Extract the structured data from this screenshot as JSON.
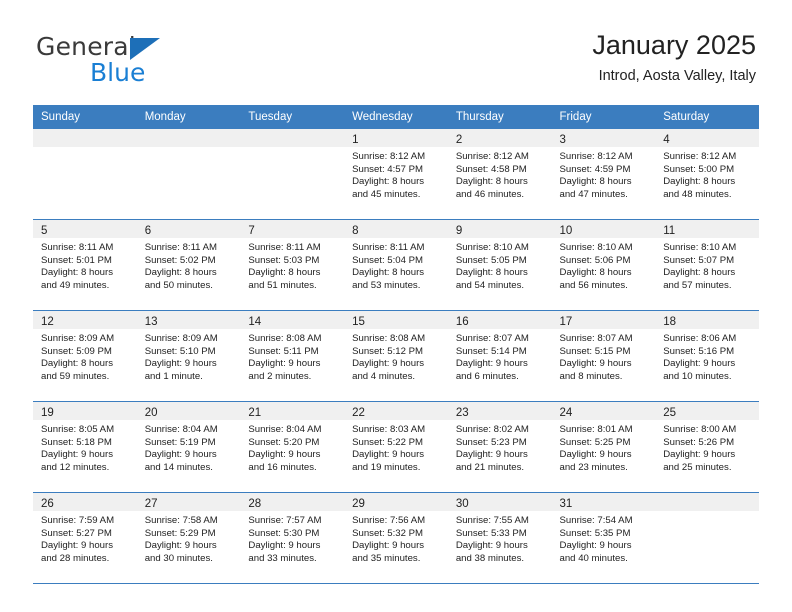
{
  "brand": {
    "name_part1": "General",
    "name_part2": "Blue",
    "accent_color": "#1a7fd4",
    "triangle_color": "#1d6fb8"
  },
  "header": {
    "title": "January 2025",
    "subtitle": "Introd, Aosta Valley, Italy"
  },
  "theme": {
    "header_row_color": "#3b7dbf",
    "day_band_color": "#f0f0f0",
    "row_divider_color": "#3b7dbf"
  },
  "weekday_headers": [
    "Sunday",
    "Monday",
    "Tuesday",
    "Wednesday",
    "Thursday",
    "Friday",
    "Saturday"
  ],
  "weeks": [
    [
      {
        "day": "",
        "sunrise": "",
        "sunset": "",
        "daylight_line1": "",
        "daylight_line2": ""
      },
      {
        "day": "",
        "sunrise": "",
        "sunset": "",
        "daylight_line1": "",
        "daylight_line2": ""
      },
      {
        "day": "",
        "sunrise": "",
        "sunset": "",
        "daylight_line1": "",
        "daylight_line2": ""
      },
      {
        "day": "1",
        "sunrise": "Sunrise: 8:12 AM",
        "sunset": "Sunset: 4:57 PM",
        "daylight_line1": "Daylight: 8 hours",
        "daylight_line2": "and 45 minutes."
      },
      {
        "day": "2",
        "sunrise": "Sunrise: 8:12 AM",
        "sunset": "Sunset: 4:58 PM",
        "daylight_line1": "Daylight: 8 hours",
        "daylight_line2": "and 46 minutes."
      },
      {
        "day": "3",
        "sunrise": "Sunrise: 8:12 AM",
        "sunset": "Sunset: 4:59 PM",
        "daylight_line1": "Daylight: 8 hours",
        "daylight_line2": "and 47 minutes."
      },
      {
        "day": "4",
        "sunrise": "Sunrise: 8:12 AM",
        "sunset": "Sunset: 5:00 PM",
        "daylight_line1": "Daylight: 8 hours",
        "daylight_line2": "and 48 minutes."
      }
    ],
    [
      {
        "day": "5",
        "sunrise": "Sunrise: 8:11 AM",
        "sunset": "Sunset: 5:01 PM",
        "daylight_line1": "Daylight: 8 hours",
        "daylight_line2": "and 49 minutes."
      },
      {
        "day": "6",
        "sunrise": "Sunrise: 8:11 AM",
        "sunset": "Sunset: 5:02 PM",
        "daylight_line1": "Daylight: 8 hours",
        "daylight_line2": "and 50 minutes."
      },
      {
        "day": "7",
        "sunrise": "Sunrise: 8:11 AM",
        "sunset": "Sunset: 5:03 PM",
        "daylight_line1": "Daylight: 8 hours",
        "daylight_line2": "and 51 minutes."
      },
      {
        "day": "8",
        "sunrise": "Sunrise: 8:11 AM",
        "sunset": "Sunset: 5:04 PM",
        "daylight_line1": "Daylight: 8 hours",
        "daylight_line2": "and 53 minutes."
      },
      {
        "day": "9",
        "sunrise": "Sunrise: 8:10 AM",
        "sunset": "Sunset: 5:05 PM",
        "daylight_line1": "Daylight: 8 hours",
        "daylight_line2": "and 54 minutes."
      },
      {
        "day": "10",
        "sunrise": "Sunrise: 8:10 AM",
        "sunset": "Sunset: 5:06 PM",
        "daylight_line1": "Daylight: 8 hours",
        "daylight_line2": "and 56 minutes."
      },
      {
        "day": "11",
        "sunrise": "Sunrise: 8:10 AM",
        "sunset": "Sunset: 5:07 PM",
        "daylight_line1": "Daylight: 8 hours",
        "daylight_line2": "and 57 minutes."
      }
    ],
    [
      {
        "day": "12",
        "sunrise": "Sunrise: 8:09 AM",
        "sunset": "Sunset: 5:09 PM",
        "daylight_line1": "Daylight: 8 hours",
        "daylight_line2": "and 59 minutes."
      },
      {
        "day": "13",
        "sunrise": "Sunrise: 8:09 AM",
        "sunset": "Sunset: 5:10 PM",
        "daylight_line1": "Daylight: 9 hours",
        "daylight_line2": "and 1 minute."
      },
      {
        "day": "14",
        "sunrise": "Sunrise: 8:08 AM",
        "sunset": "Sunset: 5:11 PM",
        "daylight_line1": "Daylight: 9 hours",
        "daylight_line2": "and 2 minutes."
      },
      {
        "day": "15",
        "sunrise": "Sunrise: 8:08 AM",
        "sunset": "Sunset: 5:12 PM",
        "daylight_line1": "Daylight: 9 hours",
        "daylight_line2": "and 4 minutes."
      },
      {
        "day": "16",
        "sunrise": "Sunrise: 8:07 AM",
        "sunset": "Sunset: 5:14 PM",
        "daylight_line1": "Daylight: 9 hours",
        "daylight_line2": "and 6 minutes."
      },
      {
        "day": "17",
        "sunrise": "Sunrise: 8:07 AM",
        "sunset": "Sunset: 5:15 PM",
        "daylight_line1": "Daylight: 9 hours",
        "daylight_line2": "and 8 minutes."
      },
      {
        "day": "18",
        "sunrise": "Sunrise: 8:06 AM",
        "sunset": "Sunset: 5:16 PM",
        "daylight_line1": "Daylight: 9 hours",
        "daylight_line2": "and 10 minutes."
      }
    ],
    [
      {
        "day": "19",
        "sunrise": "Sunrise: 8:05 AM",
        "sunset": "Sunset: 5:18 PM",
        "daylight_line1": "Daylight: 9 hours",
        "daylight_line2": "and 12 minutes."
      },
      {
        "day": "20",
        "sunrise": "Sunrise: 8:04 AM",
        "sunset": "Sunset: 5:19 PM",
        "daylight_line1": "Daylight: 9 hours",
        "daylight_line2": "and 14 minutes."
      },
      {
        "day": "21",
        "sunrise": "Sunrise: 8:04 AM",
        "sunset": "Sunset: 5:20 PM",
        "daylight_line1": "Daylight: 9 hours",
        "daylight_line2": "and 16 minutes."
      },
      {
        "day": "22",
        "sunrise": "Sunrise: 8:03 AM",
        "sunset": "Sunset: 5:22 PM",
        "daylight_line1": "Daylight: 9 hours",
        "daylight_line2": "and 19 minutes."
      },
      {
        "day": "23",
        "sunrise": "Sunrise: 8:02 AM",
        "sunset": "Sunset: 5:23 PM",
        "daylight_line1": "Daylight: 9 hours",
        "daylight_line2": "and 21 minutes."
      },
      {
        "day": "24",
        "sunrise": "Sunrise: 8:01 AM",
        "sunset": "Sunset: 5:25 PM",
        "daylight_line1": "Daylight: 9 hours",
        "daylight_line2": "and 23 minutes."
      },
      {
        "day": "25",
        "sunrise": "Sunrise: 8:00 AM",
        "sunset": "Sunset: 5:26 PM",
        "daylight_line1": "Daylight: 9 hours",
        "daylight_line2": "and 25 minutes."
      }
    ],
    [
      {
        "day": "26",
        "sunrise": "Sunrise: 7:59 AM",
        "sunset": "Sunset: 5:27 PM",
        "daylight_line1": "Daylight: 9 hours",
        "daylight_line2": "and 28 minutes."
      },
      {
        "day": "27",
        "sunrise": "Sunrise: 7:58 AM",
        "sunset": "Sunset: 5:29 PM",
        "daylight_line1": "Daylight: 9 hours",
        "daylight_line2": "and 30 minutes."
      },
      {
        "day": "28",
        "sunrise": "Sunrise: 7:57 AM",
        "sunset": "Sunset: 5:30 PM",
        "daylight_line1": "Daylight: 9 hours",
        "daylight_line2": "and 33 minutes."
      },
      {
        "day": "29",
        "sunrise": "Sunrise: 7:56 AM",
        "sunset": "Sunset: 5:32 PM",
        "daylight_line1": "Daylight: 9 hours",
        "daylight_line2": "and 35 minutes."
      },
      {
        "day": "30",
        "sunrise": "Sunrise: 7:55 AM",
        "sunset": "Sunset: 5:33 PM",
        "daylight_line1": "Daylight: 9 hours",
        "daylight_line2": "and 38 minutes."
      },
      {
        "day": "31",
        "sunrise": "Sunrise: 7:54 AM",
        "sunset": "Sunset: 5:35 PM",
        "daylight_line1": "Daylight: 9 hours",
        "daylight_line2": "and 40 minutes."
      },
      {
        "day": "",
        "sunrise": "",
        "sunset": "",
        "daylight_line1": "",
        "daylight_line2": ""
      }
    ]
  ]
}
